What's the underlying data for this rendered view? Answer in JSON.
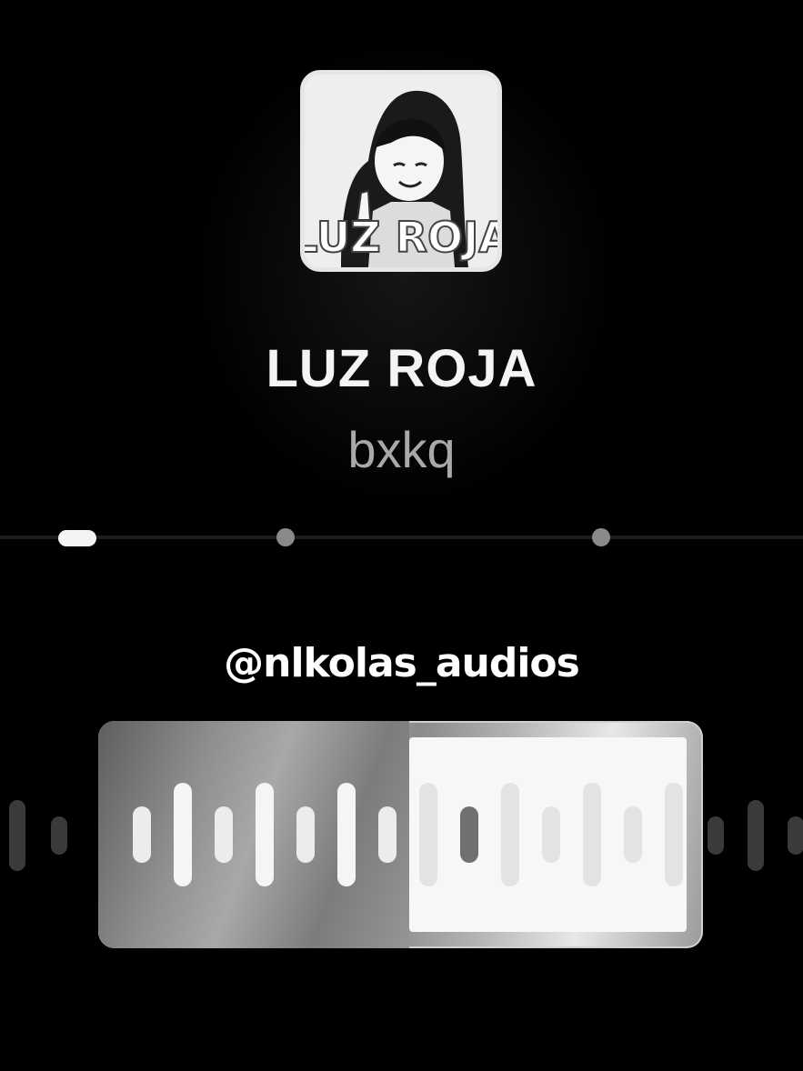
{
  "song": {
    "title": "LUZ ROJA",
    "artist": "bxkq",
    "artwork_text": "LUZ ROJA"
  },
  "watermark": "@nlkolas_audios",
  "progress": {
    "fraction": 0.0,
    "markers": 2
  },
  "icons": {
    "artwork": "album-cover-icon"
  },
  "colors": {
    "background": "#000000",
    "title": "#f4f4f4",
    "artist": "#a9a9a9"
  }
}
